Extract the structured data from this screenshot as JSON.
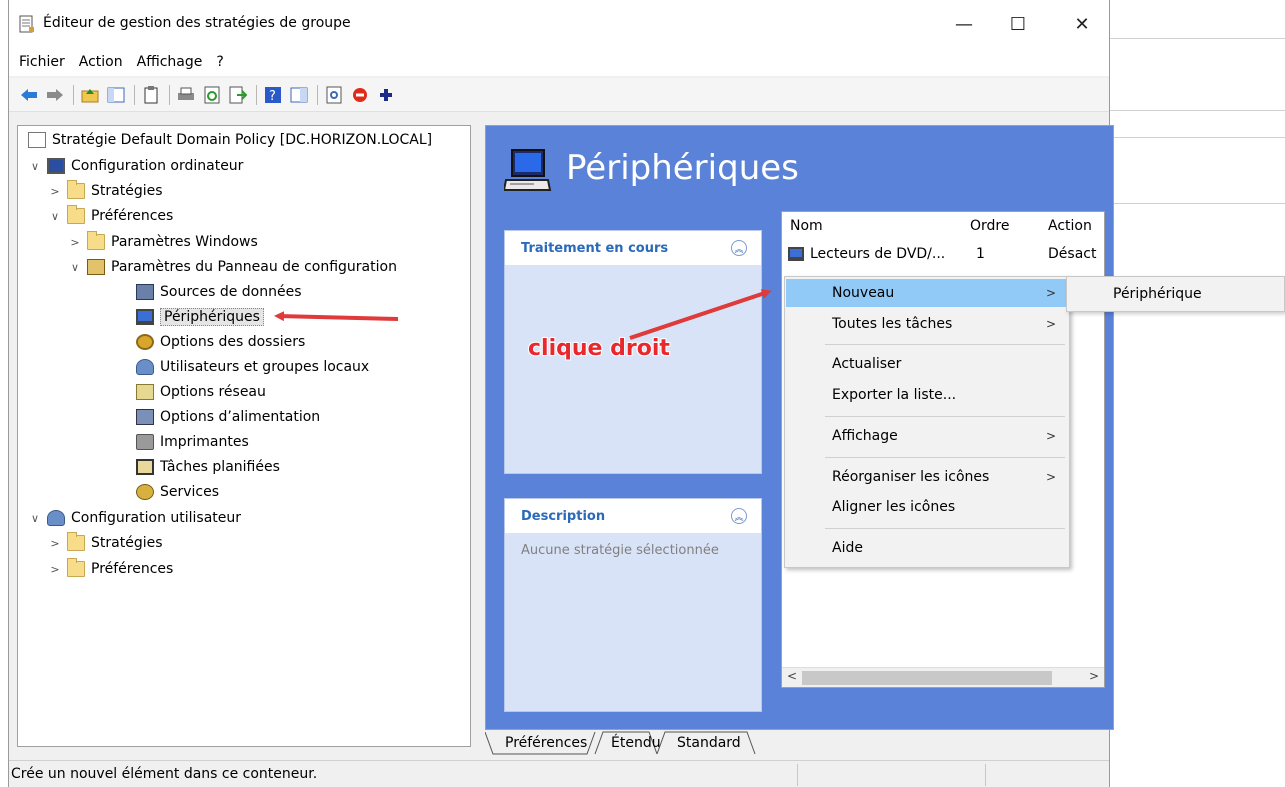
{
  "window": {
    "title": "Éditeur de gestion des stratégies de groupe",
    "minimize_glyph": "—",
    "maximize_glyph": "☐",
    "close_glyph": "✕"
  },
  "menu": {
    "items": [
      "Fichier",
      "Action",
      "Affichage",
      "?"
    ]
  },
  "toolbar": {
    "icons": [
      "back-arrow-icon",
      "forward-arrow-icon",
      "up-folder-icon",
      "show-hide-tree-icon",
      "clipboard-icon",
      "print-icon",
      "refresh-icon",
      "export-list-icon",
      "help-icon",
      "properties-icon",
      "new-view-icon",
      "stop-icon",
      "add-icon"
    ]
  },
  "tree": {
    "root": "Stratégie Default Domain Policy [DC.HORIZON.LOCAL]",
    "computer_config": "Configuration ordinateur",
    "strategies": "Stratégies",
    "preferences": "Préférences",
    "windows_settings": "Paramètres Windows",
    "control_panel_settings": "Paramètres du Panneau de configuration",
    "data_sources": "Sources de données",
    "devices": "Périphériques",
    "folder_options": "Options des dossiers",
    "local_users": "Utilisateurs et groupes locaux",
    "network_options": "Options réseau",
    "power_options": "Options d’alimentation",
    "printers": "Imprimantes",
    "scheduled_tasks": "Tâches planifiées",
    "services": "Services",
    "user_config": "Configuration utilisateur",
    "user_strategies": "Stratégies",
    "user_preferences": "Préférences"
  },
  "right": {
    "heading": "Périphériques",
    "processing_title": "Traitement en cours",
    "description_title": "Description",
    "description_text": "Aucune stratégie sélectionnée",
    "columns": [
      "Nom",
      "Ordre",
      "Action"
    ],
    "row": {
      "name": "Lecteurs de DVD/...",
      "order": "1",
      "action": "Désact"
    }
  },
  "context_menu": {
    "items": [
      {
        "label": "Nouveau",
        "submenu": true,
        "highlighted": true
      },
      {
        "label": "Toutes les tâches",
        "submenu": true
      },
      {
        "label": "Actualiser",
        "submenu": false
      },
      {
        "label": "Exporter la liste...",
        "submenu": false
      },
      {
        "label": "Affichage",
        "submenu": true
      },
      {
        "label": "Réorganiser les icônes",
        "submenu": true
      },
      {
        "label": "Aligner les icônes",
        "submenu": false
      },
      {
        "label": "Aide",
        "submenu": false
      }
    ],
    "submenu_item": "Périphérique"
  },
  "annotation": {
    "text": "clique droit",
    "color": "#e8282c"
  },
  "tabs": [
    "Préférences",
    "Étendu",
    "Standard"
  ],
  "status": {
    "text": "Crée un nouvel élément dans ce conteneur."
  },
  "colors": {
    "right_pane_bg": "#5a82d8",
    "menu_highlight": "#91c9f7",
    "card_title": "#2a6ab8"
  }
}
